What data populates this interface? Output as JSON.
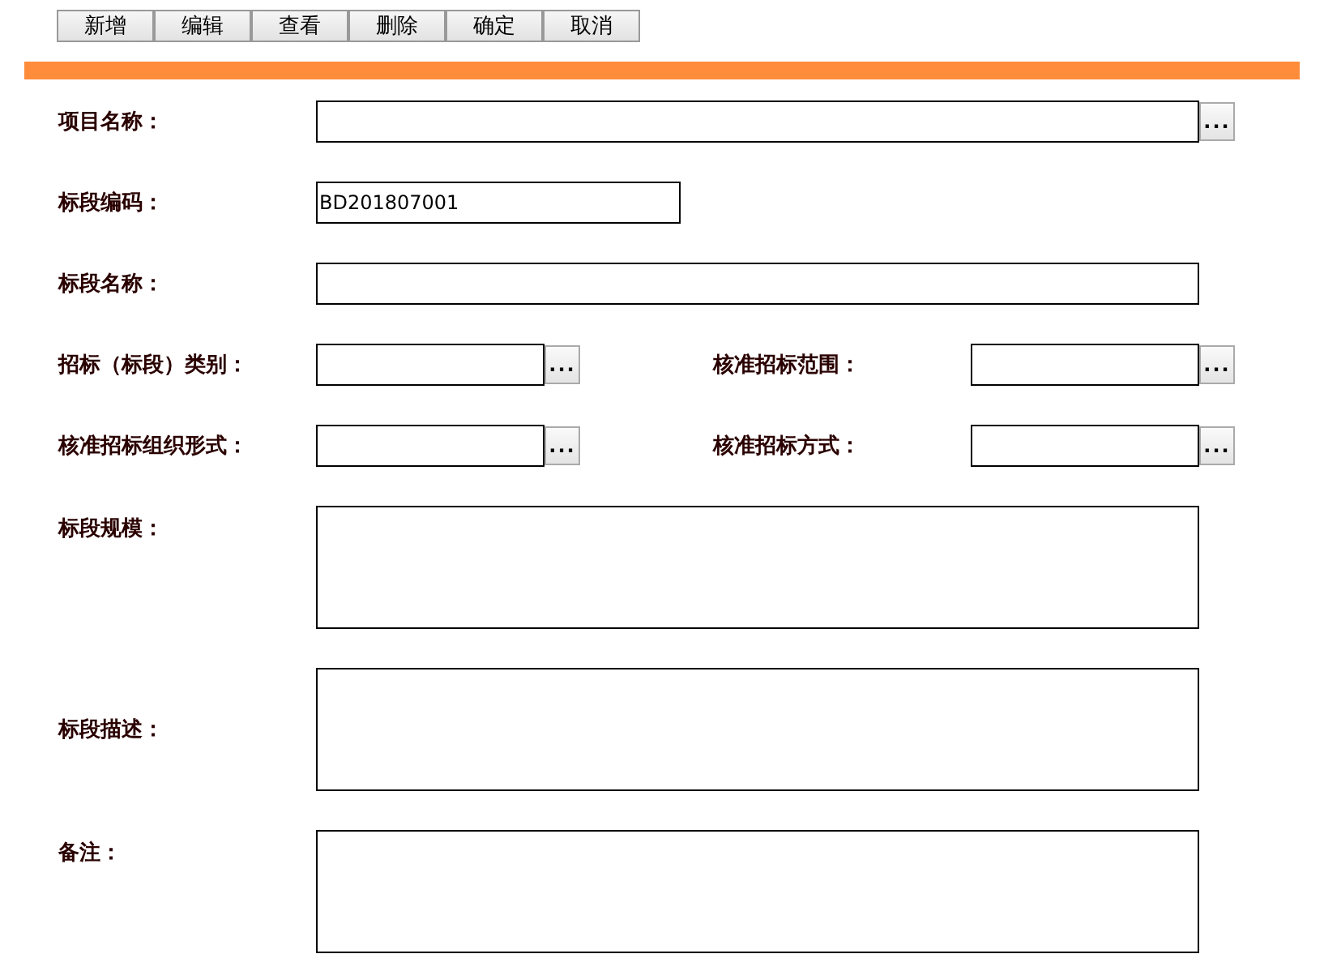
{
  "toolbar": [
    "新增",
    "编辑",
    "查看",
    "删除",
    "确定",
    "取消"
  ],
  "rows": [
    {
      "kind": "single",
      "fields": [
        {
          "label": "项目名称：",
          "kind": "lookup",
          "button": "..."
        }
      ]
    },
    {
      "kind": "single",
      "fields": [
        {
          "label": "标段编码：",
          "kind": "short",
          "value": "BD201807001"
        }
      ]
    },
    {
      "kind": "single",
      "fields": [
        {
          "label": "标段名称：",
          "kind": "text"
        }
      ]
    },
    {
      "kind": "pair",
      "fields": [
        {
          "label": "招标（标段）类别：",
          "kind": "lookup",
          "button": "..."
        },
        {
          "label": "核准招标范围：",
          "kind": "lookup",
          "button": "..."
        }
      ]
    },
    {
      "kind": "pair",
      "fields": [
        {
          "label": "核准招标组织形式：",
          "kind": "lookup",
          "button": "..."
        },
        {
          "label": "核准招标方式：",
          "kind": "lookup",
          "button": "..."
        }
      ]
    },
    {
      "kind": "areatop",
      "fields": [
        {
          "label": "标段规模：",
          "kind": "textarea"
        }
      ]
    },
    {
      "kind": "areamiddle",
      "fields": [
        {
          "label": "标段描述：",
          "kind": "textarea"
        }
      ]
    },
    {
      "kind": "areatop",
      "fields": [
        {
          "label": "备注：",
          "kind": "textarea"
        }
      ]
    }
  ]
}
